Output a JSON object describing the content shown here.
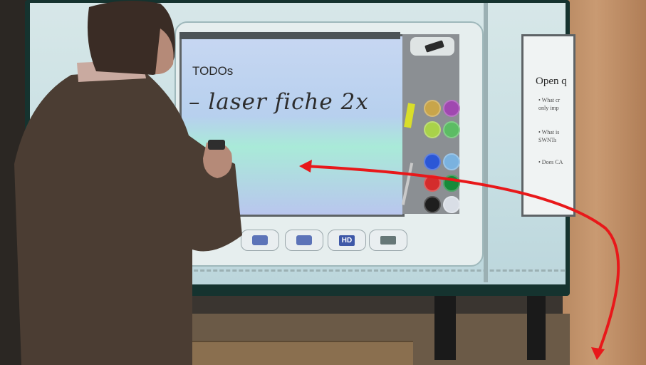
{
  "whiteboard": {
    "title": "TODOs",
    "handwriting": "– laser fiche  2x"
  },
  "toolbar": {
    "hd_label": "HD",
    "icons": [
      "monitor-icon",
      "monitor-icon",
      "hd-monitor-icon",
      "keyboard-icon"
    ]
  },
  "palette": {
    "colors": [
      "#c8a54a",
      "#a048b0",
      "#a9d24a",
      "#5cbc64",
      "#2b57d6",
      "#7ab2df",
      "#d42c2c",
      "#178a3a",
      "#1e1e1e",
      "#d9dee6"
    ]
  },
  "slide": {
    "title": "Open q",
    "bullets": [
      "• What cr",
      "  only imp",
      "• What is",
      "  SWNTs",
      "• Does CA"
    ]
  },
  "annotation": {
    "arrow_color": "#e8181a"
  }
}
